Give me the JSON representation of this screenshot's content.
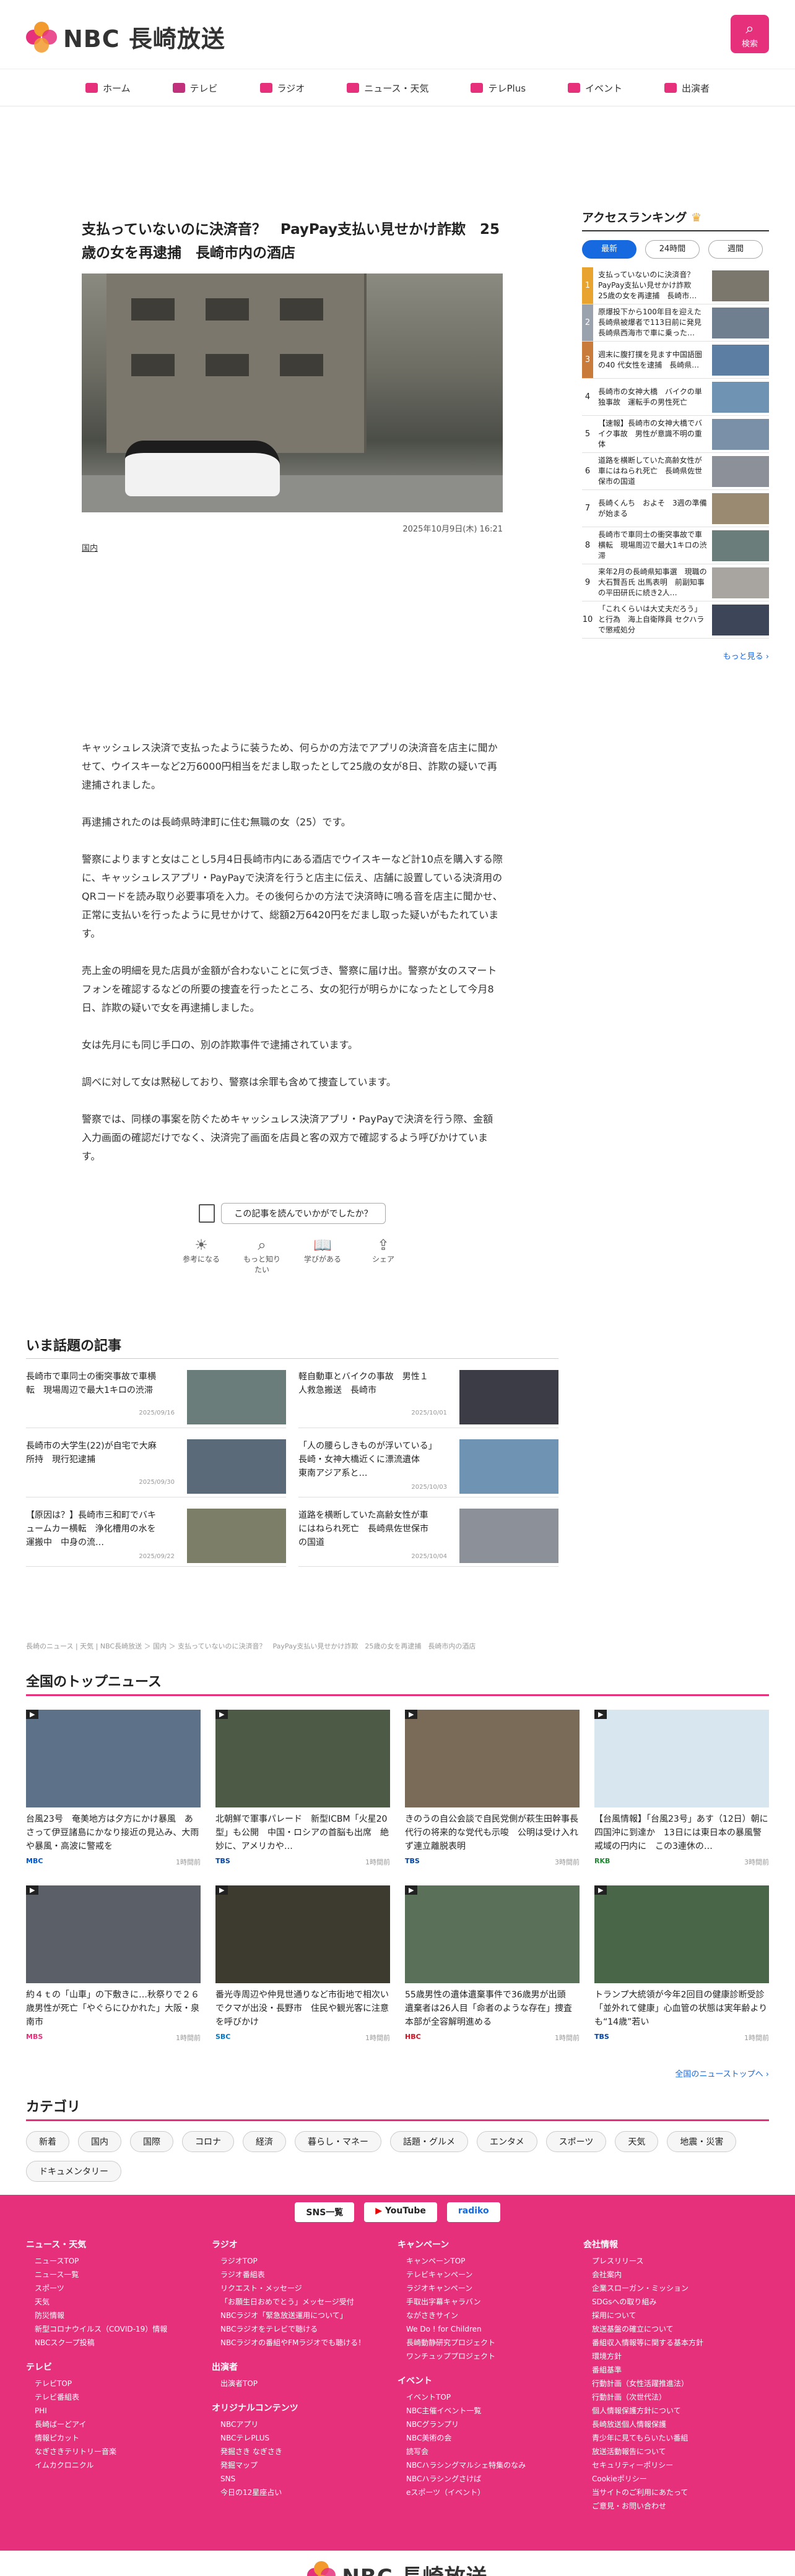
{
  "header": {
    "logo_text": "NBC 長崎放送",
    "search_label": "検索"
  },
  "nav": [
    {
      "label": "ホーム",
      "icon": "home-icon",
      "color": "#e6307b"
    },
    {
      "label": "テレビ",
      "icon": "tv-icon",
      "color": "#c0307b"
    },
    {
      "label": "ラジオ",
      "icon": "radio-icon",
      "color": "#e6307b"
    },
    {
      "label": "ニュース・天気",
      "icon": "news-icon",
      "color": "#e6307b"
    },
    {
      "label": "テレPlus",
      "icon": "play-icon",
      "color": "#e6307b"
    },
    {
      "label": "イベント",
      "icon": "calendar-icon",
      "color": "#e6307b"
    },
    {
      "label": "出演者",
      "icon": "people-icon",
      "color": "#e6307b"
    }
  ],
  "article": {
    "title": "支払っていないのに決済音？　PayPay支払い見せかけ詐欺　25歳の女を再逮捕　長崎市内の酒店",
    "date": "2025年10月9日(木) 16:21",
    "category": "国内",
    "paragraphs": [
      "キャッシュレス決済で支払ったように装うため、何らかの方法でアプリの決済音を店主に聞かせて、ウイスキーなど2万6000円相当をだまし取ったとして25歳の女が8日、詐欺の疑いで再逮捕されました。",
      "再逮捕されたのは長崎県時津町に住む無職の女（25）です。",
      "警察によりますと女はことし5月4日長崎市内にある酒店でウイスキーなど計10点を購入する際に、キャッシュレスアプリ・PayPayで決済を行うと店主に伝え、店舗に設置している決済用のQRコードを読み取り必要事項を入力。その後何らかの方法で決済時に鳴る音を店主に聞かせ、正常に支払いを行ったように見せかけて、総額2万6420円をだまし取った疑いがもたれています。",
      "売上金の明細を見た店員が金額が合わないことに気づき、警察に届け出。警察が女のスマートフォンを確認するなどの所要の捜査を行ったところ、女の犯行が明らかになったとして今月8日、詐欺の疑いで女を再逮捕しました。",
      "女は先月にも同じ手口の、別の詐欺事件で逮捕されています。",
      "調べに対して女は黙秘しており、警察は余罪も含めて捜査しています。",
      "警察では、同様の事案を防ぐためキャッシュレス決済アプリ・PayPayで決済を行う際、金額入力画面の確認だけでなく、決済完了画面を店員と客の双方で確認するよう呼びかけています。"
    ]
  },
  "feedback": {
    "question": "この記事を読んでいかがでしたか？",
    "buttons": [
      {
        "label": "参考になる",
        "icon": "lightbulb-icon"
      },
      {
        "label": "もっと知りたい",
        "icon": "search-icon"
      },
      {
        "label": "学びがある",
        "icon": "book-icon"
      },
      {
        "label": "シェア",
        "icon": "share-icon"
      }
    ]
  },
  "trending": {
    "title": "いま話題の記事",
    "items": [
      {
        "title": "長崎市で車同士の衝突事故で車横転　現場周辺で最大1キロの渋滞",
        "date": "2025/09/16",
        "color": "#6b7d7a"
      },
      {
        "title": "軽自動車とバイクの事故　男性１人救急搬送　長崎市",
        "date": "2025/10/01",
        "color": "#3c3c46"
      },
      {
        "title": "長崎市の大学生(22)が自宅で大麻所持　現行犯逮捕",
        "date": "2025/09/30",
        "color": "#5a6a78"
      },
      {
        "title": "「人の腰らしきものが浮いている」長崎・女神大橋近くに漂流遺体　東南アジア系と…",
        "date": "2025/10/03",
        "color": "#6f93b3"
      },
      {
        "title": "【原因は？】長崎市三和町でバキュームカー横転　浄化槽用の水を運搬中　中身の流…",
        "date": "2025/09/22",
        "color": "#7d7e68"
      },
      {
        "title": "道路を横断していた高齢女性が車にはねられ死亡　長崎県佐世保市の国道",
        "date": "2025/10/04",
        "color": "#8c9098"
      }
    ]
  },
  "breadcrumb": "長崎のニュース | 天気 | NBC長崎放送 ＞ 国内 ＞ 支払っていないのに決済音？　PayPay支払い見せかけ詐欺　25歳の女を再逮捕　長崎市内の酒店",
  "ranking": {
    "title": "アクセスランキング",
    "tabs": [
      "最新",
      "24時間",
      "週間"
    ],
    "items": [
      {
        "no": "1",
        "title": "支払っていないのに決済音？　PayPay支払い見せかけ詐欺　25歳の女を再逮捕　長崎市…",
        "color": "#7b776c",
        "bar": "#e9a32f"
      },
      {
        "no": "2",
        "title": "原爆投下から100年目を迎えた長崎県被爆者で113日前に発見　長崎県西海市で車に乗った…",
        "color": "#6f7f8f",
        "bar": "#9aa3ad"
      },
      {
        "no": "3",
        "title": "週末に腹打撲を見ます中国語圏の40 代女性を逮捕　長崎県…",
        "color": "#5c7ea3",
        "bar": "#c97b3b"
      },
      {
        "no": "4",
        "title": "長崎市の女神大橋　バイクの単独事故　運転手の男性死亡",
        "color": "#6f93b3",
        "bar": ""
      },
      {
        "no": "5",
        "title": "【速報】長崎市の女神大橋でバイク事故　男性が意識不明の重体",
        "color": "#7a8fa8",
        "bar": ""
      },
      {
        "no": "6",
        "title": "道路を横断していた高齢女性が車にはねられ死亡　長崎県佐世保市の国道",
        "color": "#8c9098",
        "bar": ""
      },
      {
        "no": "7",
        "title": "長崎くんち　およそ　3週の準備が始まる",
        "color": "#9b8a72",
        "bar": ""
      },
      {
        "no": "8",
        "title": "長崎市で車同士の衝突事故で車横転　現場周辺で最大1キロの渋滞",
        "color": "#6b7d7a",
        "bar": ""
      },
      {
        "no": "9",
        "title": "来年2月の長崎県知事選　現職の大石賢吾氏 出馬表明　前副知事の平田研氏に続き2人…",
        "color": "#a8a4a0",
        "bar": ""
      },
      {
        "no": "10",
        "title": "「これくらいは大丈夫だろう」と行為　海上自衛隊員 セクハラで懲戒処分",
        "color": "#3c4658",
        "bar": ""
      }
    ],
    "more": "もっと見る ›"
  },
  "national": {
    "title": "全国のトップニュース",
    "items": [
      {
        "title": "台風23号　奄美地方は夕方にかけ暴風　あさって伊豆諸島にかなり接近の見込み、大雨や暴風・高波に警戒を",
        "src": "MBC",
        "time": "1時間前",
        "color": "#5d7288",
        "src_color": "#0055cc"
      },
      {
        "title": "北朝鮮で軍事パレード　新型ICBM「火星20型」も公開　中国・ロシアの首脳も出席　絶妙に、アメリカや…",
        "src": "TBS",
        "time": "1時間前",
        "color": "#4d5a45",
        "src_color": "#0044aa"
      },
      {
        "title": "きのうの自公会談で自民党側が萩生田幹事長代行の将来的な党代も示唆　公明は受け入れず連立離脱表明",
        "src": "TBS",
        "time": "3時間前",
        "color": "#7a6a58",
        "src_color": "#0044aa"
      },
      {
        "title": "【台風情報】「台風23号」あす（12日）朝に四国沖に到達か　13日には東日本の暴風警戒域の円内に　この3連休の…",
        "src": "RKB",
        "time": "3時間前",
        "color": "#d8e6f0",
        "src_color": "#228833"
      },
      {
        "title": "約４ｔの「山車」の下敷きに…秋祭りで２６歳男性が死亡「やぐらにひかれた」大阪・泉南市",
        "src": "MBS",
        "time": "1時間前",
        "color": "#5a5f68",
        "src_color": "#e6307b"
      },
      {
        "title": "番光寺周辺や仲見世通りなど市街地で相次いでクマが出没・長野市　住民や観光客に注意を呼びかけ",
        "src": "SBC",
        "time": "1時間前",
        "color": "#3d3a30",
        "src_color": "#0077cc"
      },
      {
        "title": "55歳男性の遺体遺棄事件で36歳男が出頭　遺棄者は26人目「命者のような存在」捜査本部が全容解明進める",
        "src": "HBC",
        "time": "1時間前",
        "color": "#5a7058",
        "src_color": "#cc1122"
      },
      {
        "title": "トランプ大統領が今年2回目の健康診断受診「並外れて健康」心血管の状態は実年齢よりも“14歳”若い",
        "src": "TBS",
        "time": "1時間前",
        "color": "#4a6648",
        "src_color": "#0044aa"
      }
    ],
    "more": "全国のニューストップへ ›"
  },
  "categories": {
    "title": "カテゴリ",
    "items": [
      "新着",
      "国内",
      "国際",
      "コロナ",
      "経済",
      "暮らし・マネー",
      "話題・グルメ",
      "エンタメ",
      "スポーツ",
      "天気",
      "地震・災害",
      "ドキュメンタリー"
    ]
  },
  "footer": {
    "sns": [
      "SNS一覧",
      "YouTube",
      "radiko"
    ],
    "columns": [
      {
        "groups": [
          {
            "title": "ニュース・天気",
            "items": [
              "ニュースTOP",
              "ニュース一覧",
              "スポーツ",
              "天気",
              "防災情報",
              "新型コロナウイルス（COVID-19）情報",
              "NBCスクープ投稿"
            ]
          },
          {
            "title": "テレビ",
            "items": [
              "テレビTOP",
              "テレビ番組表",
              "PHI",
              "長崎ばーどアイ",
              "情報ピカット",
              "なぎさきテリトリー音楽",
              "イムカクロニクル"
            ]
          }
        ]
      },
      {
        "groups": [
          {
            "title": "ラジオ",
            "items": [
              "ラジオTOP",
              "ラジオ番組表",
              "リクエスト・メッセージ",
              "「お願生日おめでとう」メッセージ受付",
              "NBCラジオ「緊急放送運用について」",
              "NBCラジオをテレビで聴ける",
              "NBCラジオの番組やFMラジオでも聴ける！"
            ]
          },
          {
            "title": "出演者",
            "items": [
              "出演者TOP"
            ]
          },
          {
            "title": "オリジナルコンテンツ",
            "items": [
              "NBCアプリ",
              "NBCテレPLUS",
              "発掘さき なぎさき",
              "発掘マップ",
              "SNS",
              "今日の12星座占い"
            ]
          }
        ]
      },
      {
        "groups": [
          {
            "title": "キャンペーン",
            "items": [
              "キャンペーンTOP",
              "テレビキャンペーン",
              "ラジオキャンペーン",
              "手取出字幕キャラバン",
              "ながさきサイン",
              "We Do ! for Children",
              "長崎動静研究プロジェクト",
              "ワンチュッププロジェクト"
            ]
          },
          {
            "title": "イベント",
            "items": [
              "イベントTOP",
              "NBC主催イベント一覧",
              "NBCグランプリ",
              "NBC美術の会",
              "読写会",
              "NBCハラシングマルシェ特集のなみ",
              "NBCハラシングさけば",
              "eスポーツ（イベント）"
            ]
          }
        ]
      },
      {
        "groups": [
          {
            "title": "会社情報",
            "items": [
              "プレスリリース",
              "会社案内",
              "企業スローガン・ミッション",
              "SDGsへの取り組み",
              "採用について",
              "放送基盤の確立について",
              "番組収入情報等に関する基本方針",
              "環境方針",
              "番組基準",
              "行動計画（女性活躍推進法）",
              "行動計画（次世代法）",
              "個人情報保護方針について",
              "長崎放送個人情報保護",
              "青少年に見てもらいたい番組",
              "放送活動報告について",
              "セキュリティーポリシー",
              "Cookieポリシー",
              "当サイトのご利用にあたって",
              "ご意見・お問い合わせ"
            ]
          }
        ]
      }
    ],
    "logo_text": "NBC 長崎放送"
  }
}
